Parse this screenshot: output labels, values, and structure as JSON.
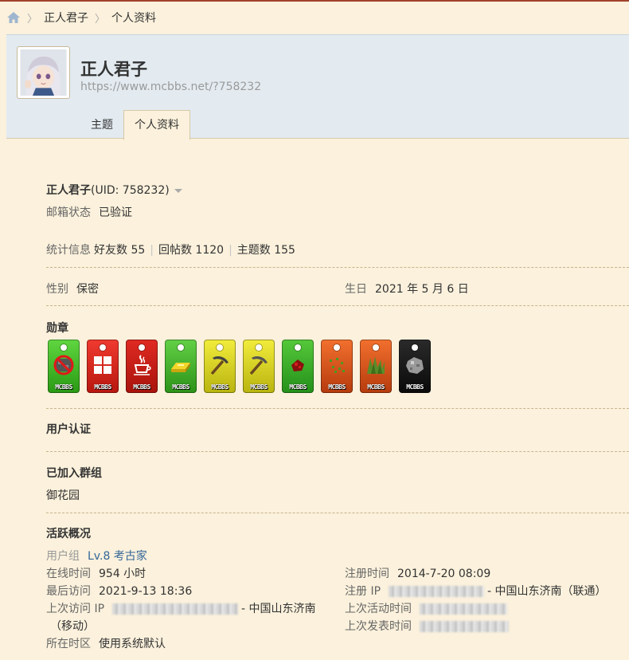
{
  "breadcrumb": {
    "items": [
      "正人君子",
      "个人资料"
    ]
  },
  "profile": {
    "name": "正人君子",
    "url": "https://www.mcbbs.net/?758232",
    "tabs": [
      "主题",
      "个人资料"
    ]
  },
  "info": {
    "name": "正人君子",
    "uid": "(UID: 758232)",
    "email_label": "邮箱状态",
    "email_value": "已验证",
    "stats_label": "统计信息",
    "friends": "好友数 55",
    "replies": "回帖数 1120",
    "threads": "主题数 155",
    "gender_label": "性别",
    "gender_value": "保密",
    "birthday_label": "生日",
    "birthday_value": "2021 年 5 月 6 日"
  },
  "medals": {
    "heading": "勋章",
    "label": "MCBBS",
    "items": [
      {
        "icon": "no-ore-icon",
        "bg": "#3fbf1f"
      },
      {
        "icon": "window-grid-icon",
        "bg": "#d9281f"
      },
      {
        "icon": "java-cup-icon",
        "bg": "#c4221c"
      },
      {
        "icon": "gold-ingot-icon",
        "bg": "#43b52a"
      },
      {
        "icon": "iron-pickaxe-icon",
        "bg": "#d8d21d"
      },
      {
        "icon": "diamond-pickaxe-icon",
        "bg": "#d8d21d"
      },
      {
        "icon": "redstone-icon",
        "bg": "#2ea81c"
      },
      {
        "icon": "seeds-icon",
        "bg": "#e0531a"
      },
      {
        "icon": "grass-icon",
        "bg": "#e0531a"
      },
      {
        "icon": "stone-icon",
        "bg": "#1a1a1a"
      }
    ]
  },
  "certification": {
    "heading": "用户认证"
  },
  "groups": {
    "heading": "已加入群组",
    "items": [
      "御花园"
    ]
  },
  "activity": {
    "heading": "活跃概况",
    "usergroup_label": "用户组",
    "usergroup_value": "Lv.8 考古家",
    "online_label": "在线时间",
    "online_value": "954 小时",
    "register_label": "注册时间",
    "register_value": "2014-7-20 08:09",
    "lastvisit_label": "最后访问",
    "lastvisit_value": "2021-9-13 18:36",
    "regip_label": "注册 IP",
    "regip_suffix": "- 中国山东济南（联通）",
    "lastip_label": "上次访问 IP",
    "lastip_suffix": "- 中国山东济南",
    "lastip_suffix2": "（移动）",
    "lastactive_label": "上次活动时间",
    "lastpost_label": "上次发表时间",
    "timezone_label": "所在时区",
    "timezone_value": "使用系统默认"
  },
  "colors": {
    "accent_link": "#336699",
    "page_bg": "#fbf1dc",
    "header_bg": "#e3ebf1"
  }
}
